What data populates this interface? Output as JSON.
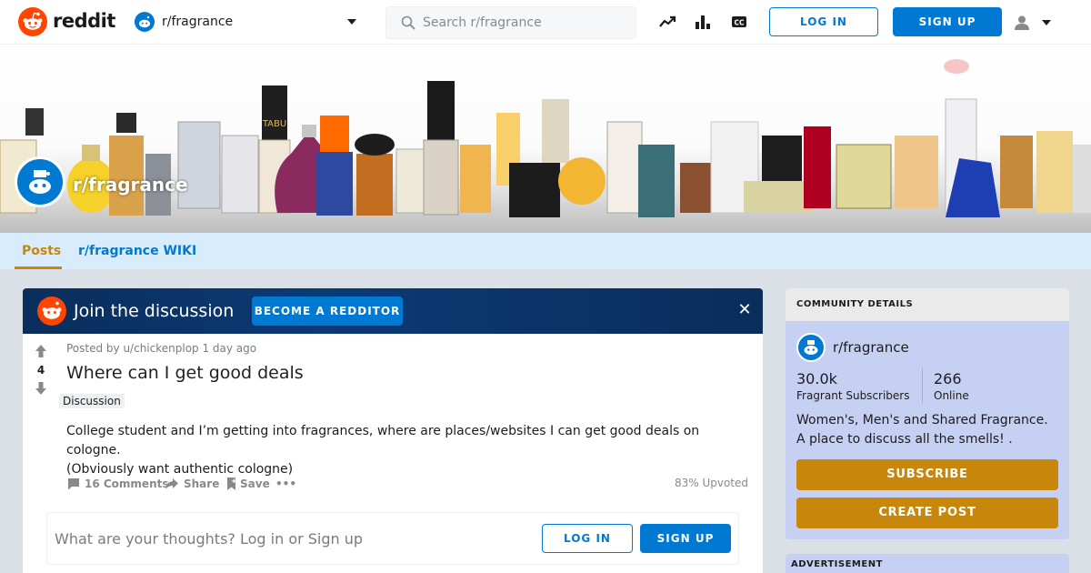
{
  "header": {
    "logo_text": "reddit",
    "community": "r/fragrance",
    "search_placeholder": "Search r/fragrance",
    "login_label": "LOG IN",
    "signup_label": "SIGN UP",
    "icons": [
      "trending-icon",
      "leaderboard-icon",
      "closed-caption-icon",
      "user-icon",
      "chevron-down-icon"
    ]
  },
  "banner": {
    "name_overlay": "r/fragrance"
  },
  "subnav": {
    "tabs": [
      {
        "label": "Posts",
        "active": true
      },
      {
        "label": "r/fragrance WIKI",
        "active": false
      }
    ]
  },
  "join": {
    "text": "Join the discussion",
    "button": "BECOME A REDDITOR",
    "close": "✕"
  },
  "post": {
    "score": "4",
    "meta": "Posted by u/chickenplop 1 day ago",
    "title": "Where can I get good deals",
    "flair": "Discussion",
    "body_lines": [
      "College student and I’m getting into fragrances, where are places/websites I can get good deals on cologne.",
      "(Obviously want authentic cologne)"
    ],
    "comments_label": "16 Comments",
    "share_label": "Share",
    "save_label": "Save",
    "more_label": "•••",
    "upvoted": "83% Upvoted",
    "comment_prompt": "What are your thoughts? Log in or Sign up",
    "login_label": "LOG IN",
    "signup_label": "SIGN UP"
  },
  "sidebar": {
    "header": "COMMUNITY DETAILS",
    "name": "r/fragrance",
    "subscribers_count": "30.0k",
    "subscribers_label": "Fragrant Subscribers",
    "online_count": "266",
    "online_label": "Online",
    "description": "Women's, Men's and Shared Fragrance. A place to discuss all the smells! .",
    "subscribe_label": "SUBSCRIBE",
    "create_post_label": "CREATE POST",
    "advertisement_label": "ADVERTISEMENT"
  },
  "colors": {
    "reddit_orange": "#ff4500",
    "blue": "#0079d3",
    "community_accent": "#c8870b",
    "sidebar_bg": "#c6d0f2",
    "nav_bg": "#d8ecfb"
  }
}
